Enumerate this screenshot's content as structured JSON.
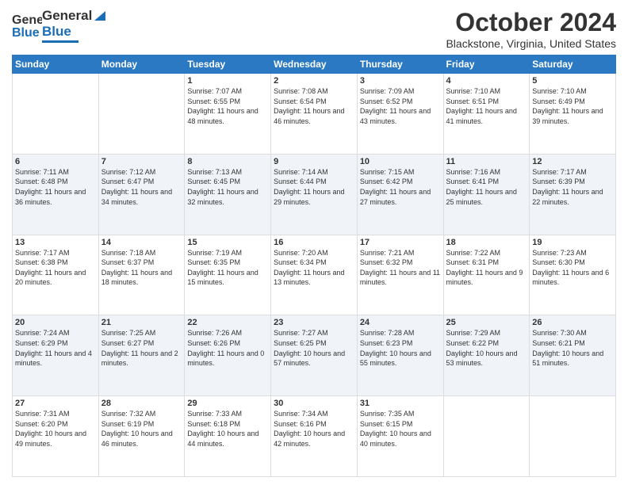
{
  "header": {
    "logo_general": "General",
    "logo_blue": "Blue",
    "title": "October 2024",
    "subtitle": "Blackstone, Virginia, United States"
  },
  "days_of_week": [
    "Sunday",
    "Monday",
    "Tuesday",
    "Wednesday",
    "Thursday",
    "Friday",
    "Saturday"
  ],
  "weeks": [
    [
      {
        "day": "",
        "sunrise": "",
        "sunset": "",
        "daylight": ""
      },
      {
        "day": "",
        "sunrise": "",
        "sunset": "",
        "daylight": ""
      },
      {
        "day": "1",
        "sunrise": "Sunrise: 7:07 AM",
        "sunset": "Sunset: 6:55 PM",
        "daylight": "Daylight: 11 hours and 48 minutes."
      },
      {
        "day": "2",
        "sunrise": "Sunrise: 7:08 AM",
        "sunset": "Sunset: 6:54 PM",
        "daylight": "Daylight: 11 hours and 46 minutes."
      },
      {
        "day": "3",
        "sunrise": "Sunrise: 7:09 AM",
        "sunset": "Sunset: 6:52 PM",
        "daylight": "Daylight: 11 hours and 43 minutes."
      },
      {
        "day": "4",
        "sunrise": "Sunrise: 7:10 AM",
        "sunset": "Sunset: 6:51 PM",
        "daylight": "Daylight: 11 hours and 41 minutes."
      },
      {
        "day": "5",
        "sunrise": "Sunrise: 7:10 AM",
        "sunset": "Sunset: 6:49 PM",
        "daylight": "Daylight: 11 hours and 39 minutes."
      }
    ],
    [
      {
        "day": "6",
        "sunrise": "Sunrise: 7:11 AM",
        "sunset": "Sunset: 6:48 PM",
        "daylight": "Daylight: 11 hours and 36 minutes."
      },
      {
        "day": "7",
        "sunrise": "Sunrise: 7:12 AM",
        "sunset": "Sunset: 6:47 PM",
        "daylight": "Daylight: 11 hours and 34 minutes."
      },
      {
        "day": "8",
        "sunrise": "Sunrise: 7:13 AM",
        "sunset": "Sunset: 6:45 PM",
        "daylight": "Daylight: 11 hours and 32 minutes."
      },
      {
        "day": "9",
        "sunrise": "Sunrise: 7:14 AM",
        "sunset": "Sunset: 6:44 PM",
        "daylight": "Daylight: 11 hours and 29 minutes."
      },
      {
        "day": "10",
        "sunrise": "Sunrise: 7:15 AM",
        "sunset": "Sunset: 6:42 PM",
        "daylight": "Daylight: 11 hours and 27 minutes."
      },
      {
        "day": "11",
        "sunrise": "Sunrise: 7:16 AM",
        "sunset": "Sunset: 6:41 PM",
        "daylight": "Daylight: 11 hours and 25 minutes."
      },
      {
        "day": "12",
        "sunrise": "Sunrise: 7:17 AM",
        "sunset": "Sunset: 6:39 PM",
        "daylight": "Daylight: 11 hours and 22 minutes."
      }
    ],
    [
      {
        "day": "13",
        "sunrise": "Sunrise: 7:17 AM",
        "sunset": "Sunset: 6:38 PM",
        "daylight": "Daylight: 11 hours and 20 minutes."
      },
      {
        "day": "14",
        "sunrise": "Sunrise: 7:18 AM",
        "sunset": "Sunset: 6:37 PM",
        "daylight": "Daylight: 11 hours and 18 minutes."
      },
      {
        "day": "15",
        "sunrise": "Sunrise: 7:19 AM",
        "sunset": "Sunset: 6:35 PM",
        "daylight": "Daylight: 11 hours and 15 minutes."
      },
      {
        "day": "16",
        "sunrise": "Sunrise: 7:20 AM",
        "sunset": "Sunset: 6:34 PM",
        "daylight": "Daylight: 11 hours and 13 minutes."
      },
      {
        "day": "17",
        "sunrise": "Sunrise: 7:21 AM",
        "sunset": "Sunset: 6:32 PM",
        "daylight": "Daylight: 11 hours and 11 minutes."
      },
      {
        "day": "18",
        "sunrise": "Sunrise: 7:22 AM",
        "sunset": "Sunset: 6:31 PM",
        "daylight": "Daylight: 11 hours and 9 minutes."
      },
      {
        "day": "19",
        "sunrise": "Sunrise: 7:23 AM",
        "sunset": "Sunset: 6:30 PM",
        "daylight": "Daylight: 11 hours and 6 minutes."
      }
    ],
    [
      {
        "day": "20",
        "sunrise": "Sunrise: 7:24 AM",
        "sunset": "Sunset: 6:29 PM",
        "daylight": "Daylight: 11 hours and 4 minutes."
      },
      {
        "day": "21",
        "sunrise": "Sunrise: 7:25 AM",
        "sunset": "Sunset: 6:27 PM",
        "daylight": "Daylight: 11 hours and 2 minutes."
      },
      {
        "day": "22",
        "sunrise": "Sunrise: 7:26 AM",
        "sunset": "Sunset: 6:26 PM",
        "daylight": "Daylight: 11 hours and 0 minutes."
      },
      {
        "day": "23",
        "sunrise": "Sunrise: 7:27 AM",
        "sunset": "Sunset: 6:25 PM",
        "daylight": "Daylight: 10 hours and 57 minutes."
      },
      {
        "day": "24",
        "sunrise": "Sunrise: 7:28 AM",
        "sunset": "Sunset: 6:23 PM",
        "daylight": "Daylight: 10 hours and 55 minutes."
      },
      {
        "day": "25",
        "sunrise": "Sunrise: 7:29 AM",
        "sunset": "Sunset: 6:22 PM",
        "daylight": "Daylight: 10 hours and 53 minutes."
      },
      {
        "day": "26",
        "sunrise": "Sunrise: 7:30 AM",
        "sunset": "Sunset: 6:21 PM",
        "daylight": "Daylight: 10 hours and 51 minutes."
      }
    ],
    [
      {
        "day": "27",
        "sunrise": "Sunrise: 7:31 AM",
        "sunset": "Sunset: 6:20 PM",
        "daylight": "Daylight: 10 hours and 49 minutes."
      },
      {
        "day": "28",
        "sunrise": "Sunrise: 7:32 AM",
        "sunset": "Sunset: 6:19 PM",
        "daylight": "Daylight: 10 hours and 46 minutes."
      },
      {
        "day": "29",
        "sunrise": "Sunrise: 7:33 AM",
        "sunset": "Sunset: 6:18 PM",
        "daylight": "Daylight: 10 hours and 44 minutes."
      },
      {
        "day": "30",
        "sunrise": "Sunrise: 7:34 AM",
        "sunset": "Sunset: 6:16 PM",
        "daylight": "Daylight: 10 hours and 42 minutes."
      },
      {
        "day": "31",
        "sunrise": "Sunrise: 7:35 AM",
        "sunset": "Sunset: 6:15 PM",
        "daylight": "Daylight: 10 hours and 40 minutes."
      },
      {
        "day": "",
        "sunrise": "",
        "sunset": "",
        "daylight": ""
      },
      {
        "day": "",
        "sunrise": "",
        "sunset": "",
        "daylight": ""
      }
    ]
  ]
}
